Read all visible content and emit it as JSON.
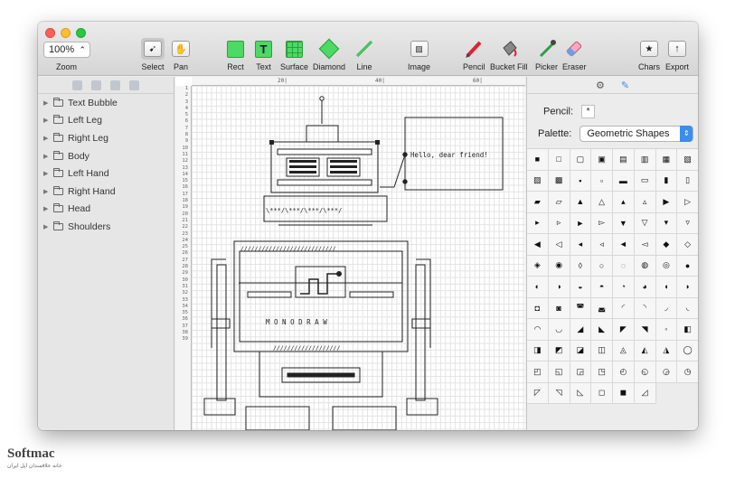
{
  "toolbar": {
    "zoom_value": "100%",
    "zoom_label": "Zoom",
    "tools": [
      {
        "label": "Select"
      },
      {
        "label": "Pan"
      },
      {
        "label": "Rect"
      },
      {
        "label": "Text"
      },
      {
        "label": "Surface"
      },
      {
        "label": "Diamond"
      },
      {
        "label": "Line"
      },
      {
        "label": "Image"
      },
      {
        "label": "Pencil"
      },
      {
        "label": "Bucket Fill"
      },
      {
        "label": "Picker"
      },
      {
        "label": "Eraser"
      },
      {
        "label": "Chars"
      },
      {
        "label": "Export"
      }
    ],
    "text_tool_glyph": "T"
  },
  "sidebar": {
    "layers": [
      "Text Bubble",
      "Left Leg",
      "Right Leg",
      "Body",
      "Left Hand",
      "Right Hand",
      "Head",
      "Shoulders"
    ]
  },
  "canvas": {
    "ruler_marks": [
      "20|",
      "40|",
      "60|"
    ],
    "line_numbers": [
      "1",
      "2",
      "3",
      "4",
      "5",
      "6",
      "7",
      "8",
      "9",
      "10",
      "11",
      "12",
      "13",
      "14",
      "15",
      "16",
      "17",
      "18",
      "19",
      "20",
      "21",
      "22",
      "23",
      "24",
      "25",
      "26",
      "27",
      "28",
      "29",
      "30",
      "31",
      "32",
      "33",
      "34",
      "35",
      "36",
      "37",
      "38",
      "39"
    ],
    "bubble_text": "Hello, dear friend!",
    "body_text": "M O N O D R A W",
    "shoulder_text": "\\***/\\***/\\***/\\***/",
    "hatch_text": "///////////////////////////",
    "hatch_text2": "///////////////////"
  },
  "inspector": {
    "pencil_label": "Pencil:",
    "pencil_char": "*",
    "palette_label": "Palette:",
    "palette_value": "Geometric Shapes",
    "glyphs": [
      "■",
      "□",
      "▢",
      "▣",
      "▤",
      "▥",
      "▦",
      "▧",
      "▨",
      "▩",
      "▪",
      "▫",
      "▬",
      "▭",
      "▮",
      "▯",
      "▰",
      "▱",
      "▲",
      "△",
      "▴",
      "▵",
      "▶",
      "▷",
      "▸",
      "▹",
      "►",
      "▻",
      "▼",
      "▽",
      "▾",
      "▿",
      "◀",
      "◁",
      "◂",
      "◃",
      "◄",
      "◅",
      "◆",
      "◇",
      "◈",
      "◉",
      "◊",
      "○",
      "◌",
      "◍",
      "◎",
      "●",
      "◐",
      "◑",
      "◒",
      "◓",
      "◔",
      "◕",
      "◖",
      "◗",
      "◘",
      "◙",
      "◚",
      "◛",
      "◜",
      "◝",
      "◞",
      "◟",
      "◠",
      "◡",
      "◢",
      "◣",
      "◤",
      "◥",
      "◦",
      "◧",
      "◨",
      "◩",
      "◪",
      "◫",
      "◬",
      "◭",
      "◮",
      "◯",
      "◰",
      "◱",
      "◲",
      "◳",
      "◴",
      "◵",
      "◶",
      "◷",
      "◸",
      "◹",
      "◺",
      "◻",
      "◼",
      "◿"
    ]
  },
  "watermark": {
    "brand": "Softmac",
    "tagline": "خانه علاقمندان اپل ایران"
  }
}
